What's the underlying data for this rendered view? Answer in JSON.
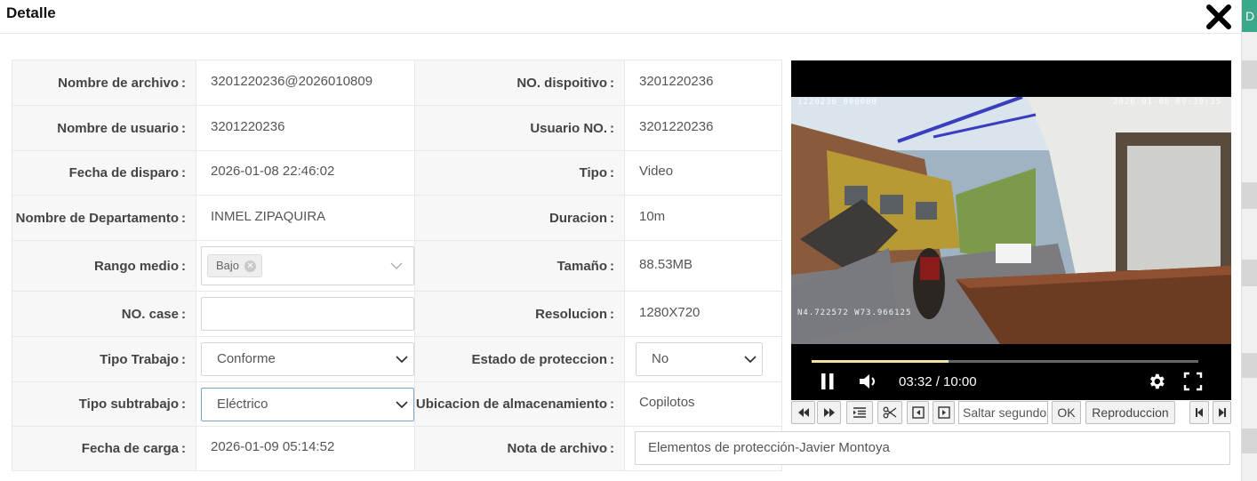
{
  "dialog": {
    "title": "Detalle"
  },
  "right_strip": {
    "tab_label": "D"
  },
  "form": {
    "archivo": {
      "label": "Nombre de archivo",
      "value": "3201220236@2026010809"
    },
    "dispositivo": {
      "label": "NO. dispoitivo",
      "value": "3201220236"
    },
    "usuario": {
      "label": "Nombre de usuario",
      "value": "3201220236"
    },
    "usuario_no": {
      "label": "Usuario NO.",
      "value": "3201220236"
    },
    "fecha_disparo": {
      "label": "Fecha de disparo",
      "value": "2026-01-08 22:46:02"
    },
    "tipo": {
      "label": "Tipo",
      "value": "Video"
    },
    "departamento": {
      "label": "Nombre de Departamento",
      "value": "INMEL ZIPAQUIRA"
    },
    "duracion": {
      "label": "Duracion",
      "value": "10m"
    },
    "rango": {
      "label": "Rango medio",
      "tag": "Bajo"
    },
    "tamano": {
      "label": "Tamaño",
      "value": "88.53MB"
    },
    "case": {
      "label": "NO. case",
      "value": ""
    },
    "resolucion": {
      "label": "Resolucion",
      "value": "1280X720"
    },
    "tipo_trabajo": {
      "label": "Tipo Trabajo",
      "value": "Conforme"
    },
    "proteccion": {
      "label": "Estado de proteccion",
      "value": "No"
    },
    "subtrabajo": {
      "label": "Tipo subtrabajo",
      "value": "Eléctrico"
    },
    "almacenamiento": {
      "label": "Ubicacion de almacenamiento",
      "value": "Copilotos"
    },
    "fecha_carga": {
      "label": "Fecha de carga",
      "value": "2026-01-09 05:14:52"
    },
    "nota": {
      "label": "Nota de archivo",
      "value": "Elementos de protección-Javier Montoya"
    },
    "colon": ":"
  },
  "player": {
    "osd_device": "1220236_000000",
    "osd_datetime": "2026-01-08 09:39:35",
    "osd_gps": "N4.722572 W73.966125",
    "time": "03:32 / 10:00",
    "progress_fraction": 0.353
  },
  "toolbar": {
    "jump_placeholder": "Saltar segundos",
    "ok_label": "OK",
    "playback_label": "Reproduccion"
  },
  "colors": {
    "accent": "#3aa88a",
    "progress": "#f1e2a6",
    "label_bg": "#f7f7f7"
  }
}
